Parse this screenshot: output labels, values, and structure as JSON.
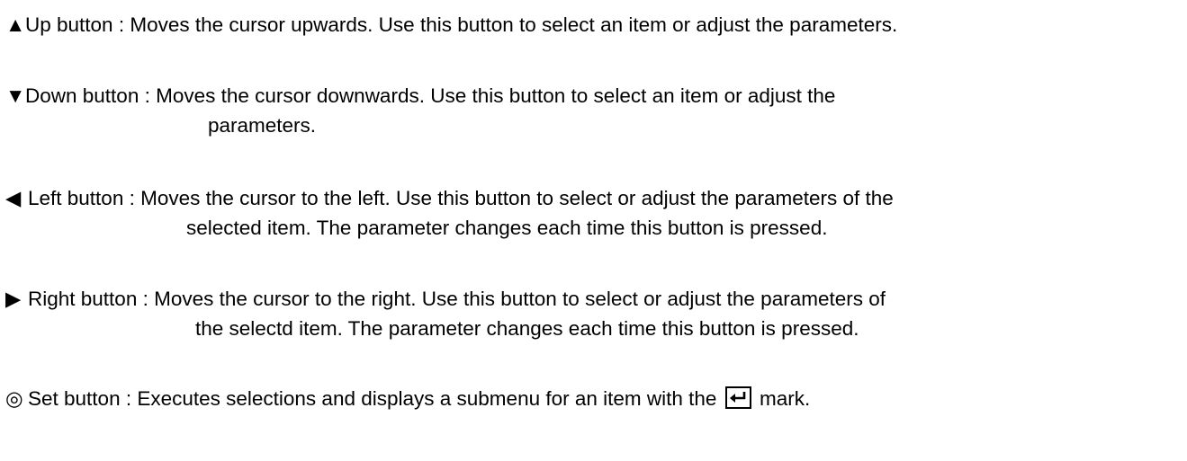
{
  "items": [
    {
      "symbol": "▲",
      "icon": "up-triangle-icon",
      "line1": "Up button : Moves the cursor upwards. Use this button to select an item or adjust the parameters."
    },
    {
      "symbol": "▼",
      "icon": "down-triangle-icon",
      "line1": "Down button : Moves the cursor downwards. Use this button to select an item or adjust the",
      "line2": "parameters."
    },
    {
      "symbol": "◀",
      "icon": "left-triangle-icon",
      "line1": "Left button : Moves the cursor to the left. Use this button to select or adjust the parameters of the",
      "line2": "selected item. The parameter changes each time this button is pressed."
    },
    {
      "symbol": "▶",
      "icon": "right-triangle-icon",
      "line1": "Right button : Moves the cursor to the right. Use this button to select or adjust the parameters of",
      "line2": "the selectd item. The parameter changes each time this button is pressed."
    },
    {
      "symbol": "◎",
      "icon": "set-bullseye-icon",
      "line1_before": "Set button : Executes selections and displays a submenu for an item with the",
      "line1_after": "mark.",
      "mark_icon": "enter-return-icon"
    }
  ]
}
